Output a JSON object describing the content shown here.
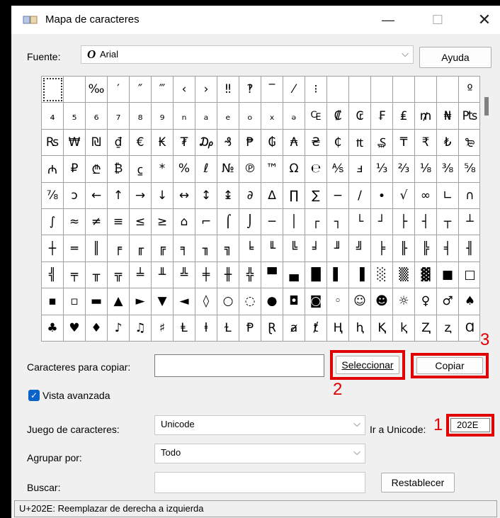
{
  "window": {
    "title": "Mapa de caracteres"
  },
  "icons": {
    "app": "character-map-icon",
    "minimize": "minimize-icon",
    "maximize": "maximize-icon",
    "close": "close-icon",
    "chevron": "chevron-down-icon",
    "check": "checkmark-icon"
  },
  "font_row": {
    "label": "Fuente:",
    "value": "Arial",
    "glyph": "O",
    "help_label": "Ayuda"
  },
  "grid": {
    "rows": [
      [
        "",
        "",
        "‰",
        "′",
        "″",
        "‴",
        "‹",
        "›",
        "‼",
        "‽",
        "‾",
        "⁄",
        "⁝",
        "",
        "",
        "",
        "",
        "",
        "",
        "º"
      ],
      [
        "₄",
        "₅",
        "₆",
        "₇",
        "₈",
        "₉",
        "ₙ",
        "ₐ",
        "ₑ",
        "ₒ",
        "ₓ",
        "ₔ",
        "₠",
        "₡",
        "₢",
        "₣",
        "₤",
        "₥",
        "₦",
        "₧"
      ],
      [
        "₨",
        "₩",
        "₪",
        "₫",
        "€",
        "₭",
        "₮",
        "₯",
        "₰",
        "₱",
        "₲",
        "₳",
        "₴",
        "₵",
        "₶",
        "₷",
        "₸",
        "₹",
        "₺",
        "₻"
      ],
      [
        "₼",
        "₽",
        "₾",
        "₿",
        "⃀",
        "*",
        "%",
        "ℓ",
        "№",
        "℗",
        "™",
        "Ω",
        "℮",
        "⅍",
        "ⅎ",
        "⅓",
        "⅔",
        "⅛",
        "⅜",
        "⅝"
      ],
      [
        "⅞",
        "ↄ",
        "←",
        "↑",
        "→",
        "↓",
        "↔",
        "↕",
        "↨",
        "∂",
        "∆",
        "∏",
        "∑",
        "−",
        "∕",
        "∙",
        "√",
        "∞",
        "∟",
        "∩"
      ],
      [
        "∫",
        "≈",
        "≠",
        "≡",
        "≤",
        "≥",
        "⌂",
        "⌐",
        "⌠",
        "⌡",
        "─",
        "│",
        "┌",
        "┐",
        "└",
        "┘",
        "├",
        "┤",
        "┬",
        "┴"
      ],
      [
        "┼",
        "═",
        "║",
        "╒",
        "╓",
        "╔",
        "╕",
        "╖",
        "╗",
        "╘",
        "╙",
        "╚",
        "╛",
        "╜",
        "╝",
        "╞",
        "╟",
        "╠",
        "╡",
        "╢"
      ],
      [
        "╣",
        "╤",
        "╥",
        "╦",
        "╧",
        "╨",
        "╩",
        "╪",
        "╫",
        "╬",
        "▀",
        "▄",
        "█",
        "▌",
        "▐",
        "░",
        "▒",
        "▓",
        "■",
        "□"
      ],
      [
        "▪",
        "▫",
        "▬",
        "▲",
        "►",
        "▼",
        "◄",
        "◊",
        "○",
        "◌",
        "●",
        "◘",
        "◙",
        "◦",
        "☺",
        "☻",
        "☼",
        "♀",
        "♂",
        "♠"
      ],
      [
        "♣",
        "♥",
        "♦",
        "♪",
        "♫",
        "♯",
        "Ⱡ",
        "ⱡ",
        "Ɫ",
        "Ᵽ",
        "Ɽ",
        "ⱥ",
        "ⱦ",
        "Ⱨ",
        "ⱨ",
        "Ⱪ",
        "ⱪ",
        "Ⱬ",
        "ⱬ",
        "Ɑ"
      ]
    ]
  },
  "copy_row": {
    "label": "Caracteres para copiar:",
    "value": "",
    "select_label": "Seleccionar",
    "copy_label": "Copiar"
  },
  "advanced": {
    "label": "Vista avanzada",
    "checked": true
  },
  "charset": {
    "label": "Juego de caracteres:",
    "value": "Unicode",
    "goto_label": "Ir a Unicode:",
    "goto_value": "202E"
  },
  "group": {
    "label": "Agrupar por:",
    "value": "Todo"
  },
  "search": {
    "label": "Buscar:",
    "value": "",
    "reset_label": "Restablecer"
  },
  "status": {
    "text": "U+202E: Reemplazar de derecha a izquierda"
  },
  "annotations": {
    "step1": "1",
    "step2": "2",
    "step3": "3",
    "color": "#e00000"
  }
}
